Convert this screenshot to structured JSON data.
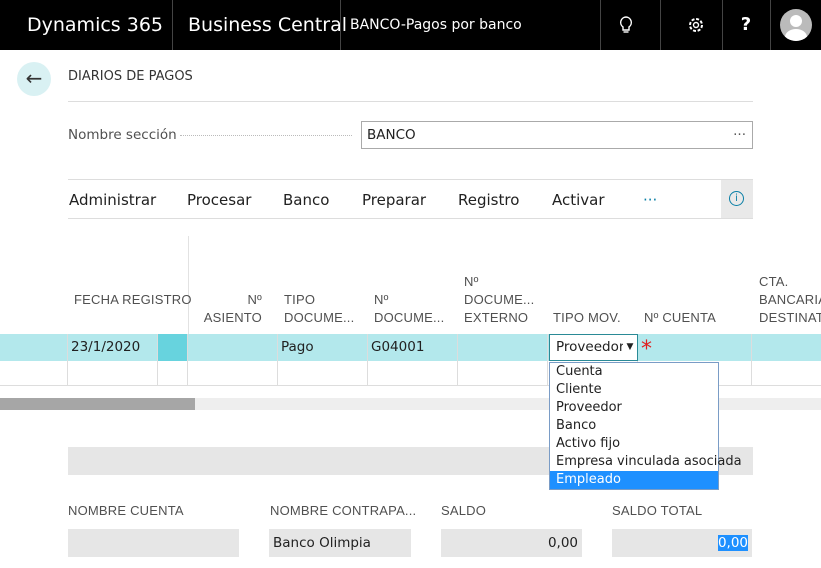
{
  "header": {
    "app": "Dynamics 365",
    "product": "Business Central",
    "page": "BANCO-Pagos por banco",
    "icons": [
      "lightbulb-icon",
      "gear-icon",
      "help-icon",
      "user-avatar"
    ],
    "help_label": "?"
  },
  "page": {
    "title": "DIARIOS DE PAGOS",
    "section_label": "Nombre sección",
    "section_value": "BANCO",
    "section_more": "···"
  },
  "menu": {
    "items": [
      "Administrar",
      "Procesar",
      "Banco",
      "Preparar",
      "Registro",
      "Activar"
    ],
    "more": "···",
    "info": "i"
  },
  "grid": {
    "columns": [
      "FECHA REGISTRO",
      "Nº ASIENTO",
      "TIPO DOCUME...",
      "Nº DOCUME...",
      "Nº DOCUME... EXTERNO",
      "TIPO MOV.",
      "Nº CUENTA",
      "CTA. BANCARIA DESTINAT."
    ],
    "rows": [
      {
        "fecha": "23/1/2020",
        "asiento": "",
        "tipo_doc": "Pago",
        "n_doc": "G04001",
        "externo": "",
        "tipo_mov": "Proveedor",
        "required": "*"
      }
    ]
  },
  "dropdown": {
    "options": [
      "Cuenta",
      "Cliente",
      "Proveedor",
      "Banco",
      "Activo fijo",
      "Empresa vinculada asociada",
      "Empleado"
    ],
    "highlighted": "Empleado"
  },
  "footer": {
    "labels": [
      "NOMBRE CUENTA",
      "NOMBRE CONTRAPA...",
      "SALDO",
      "SALDO TOTAL"
    ],
    "values": [
      "",
      "Banco Olimpia",
      "0,00",
      "0,00"
    ]
  },
  "colors": {
    "accent": "#00b7c3",
    "row": "#b3e8ec",
    "highlight": "#1e90ff"
  }
}
